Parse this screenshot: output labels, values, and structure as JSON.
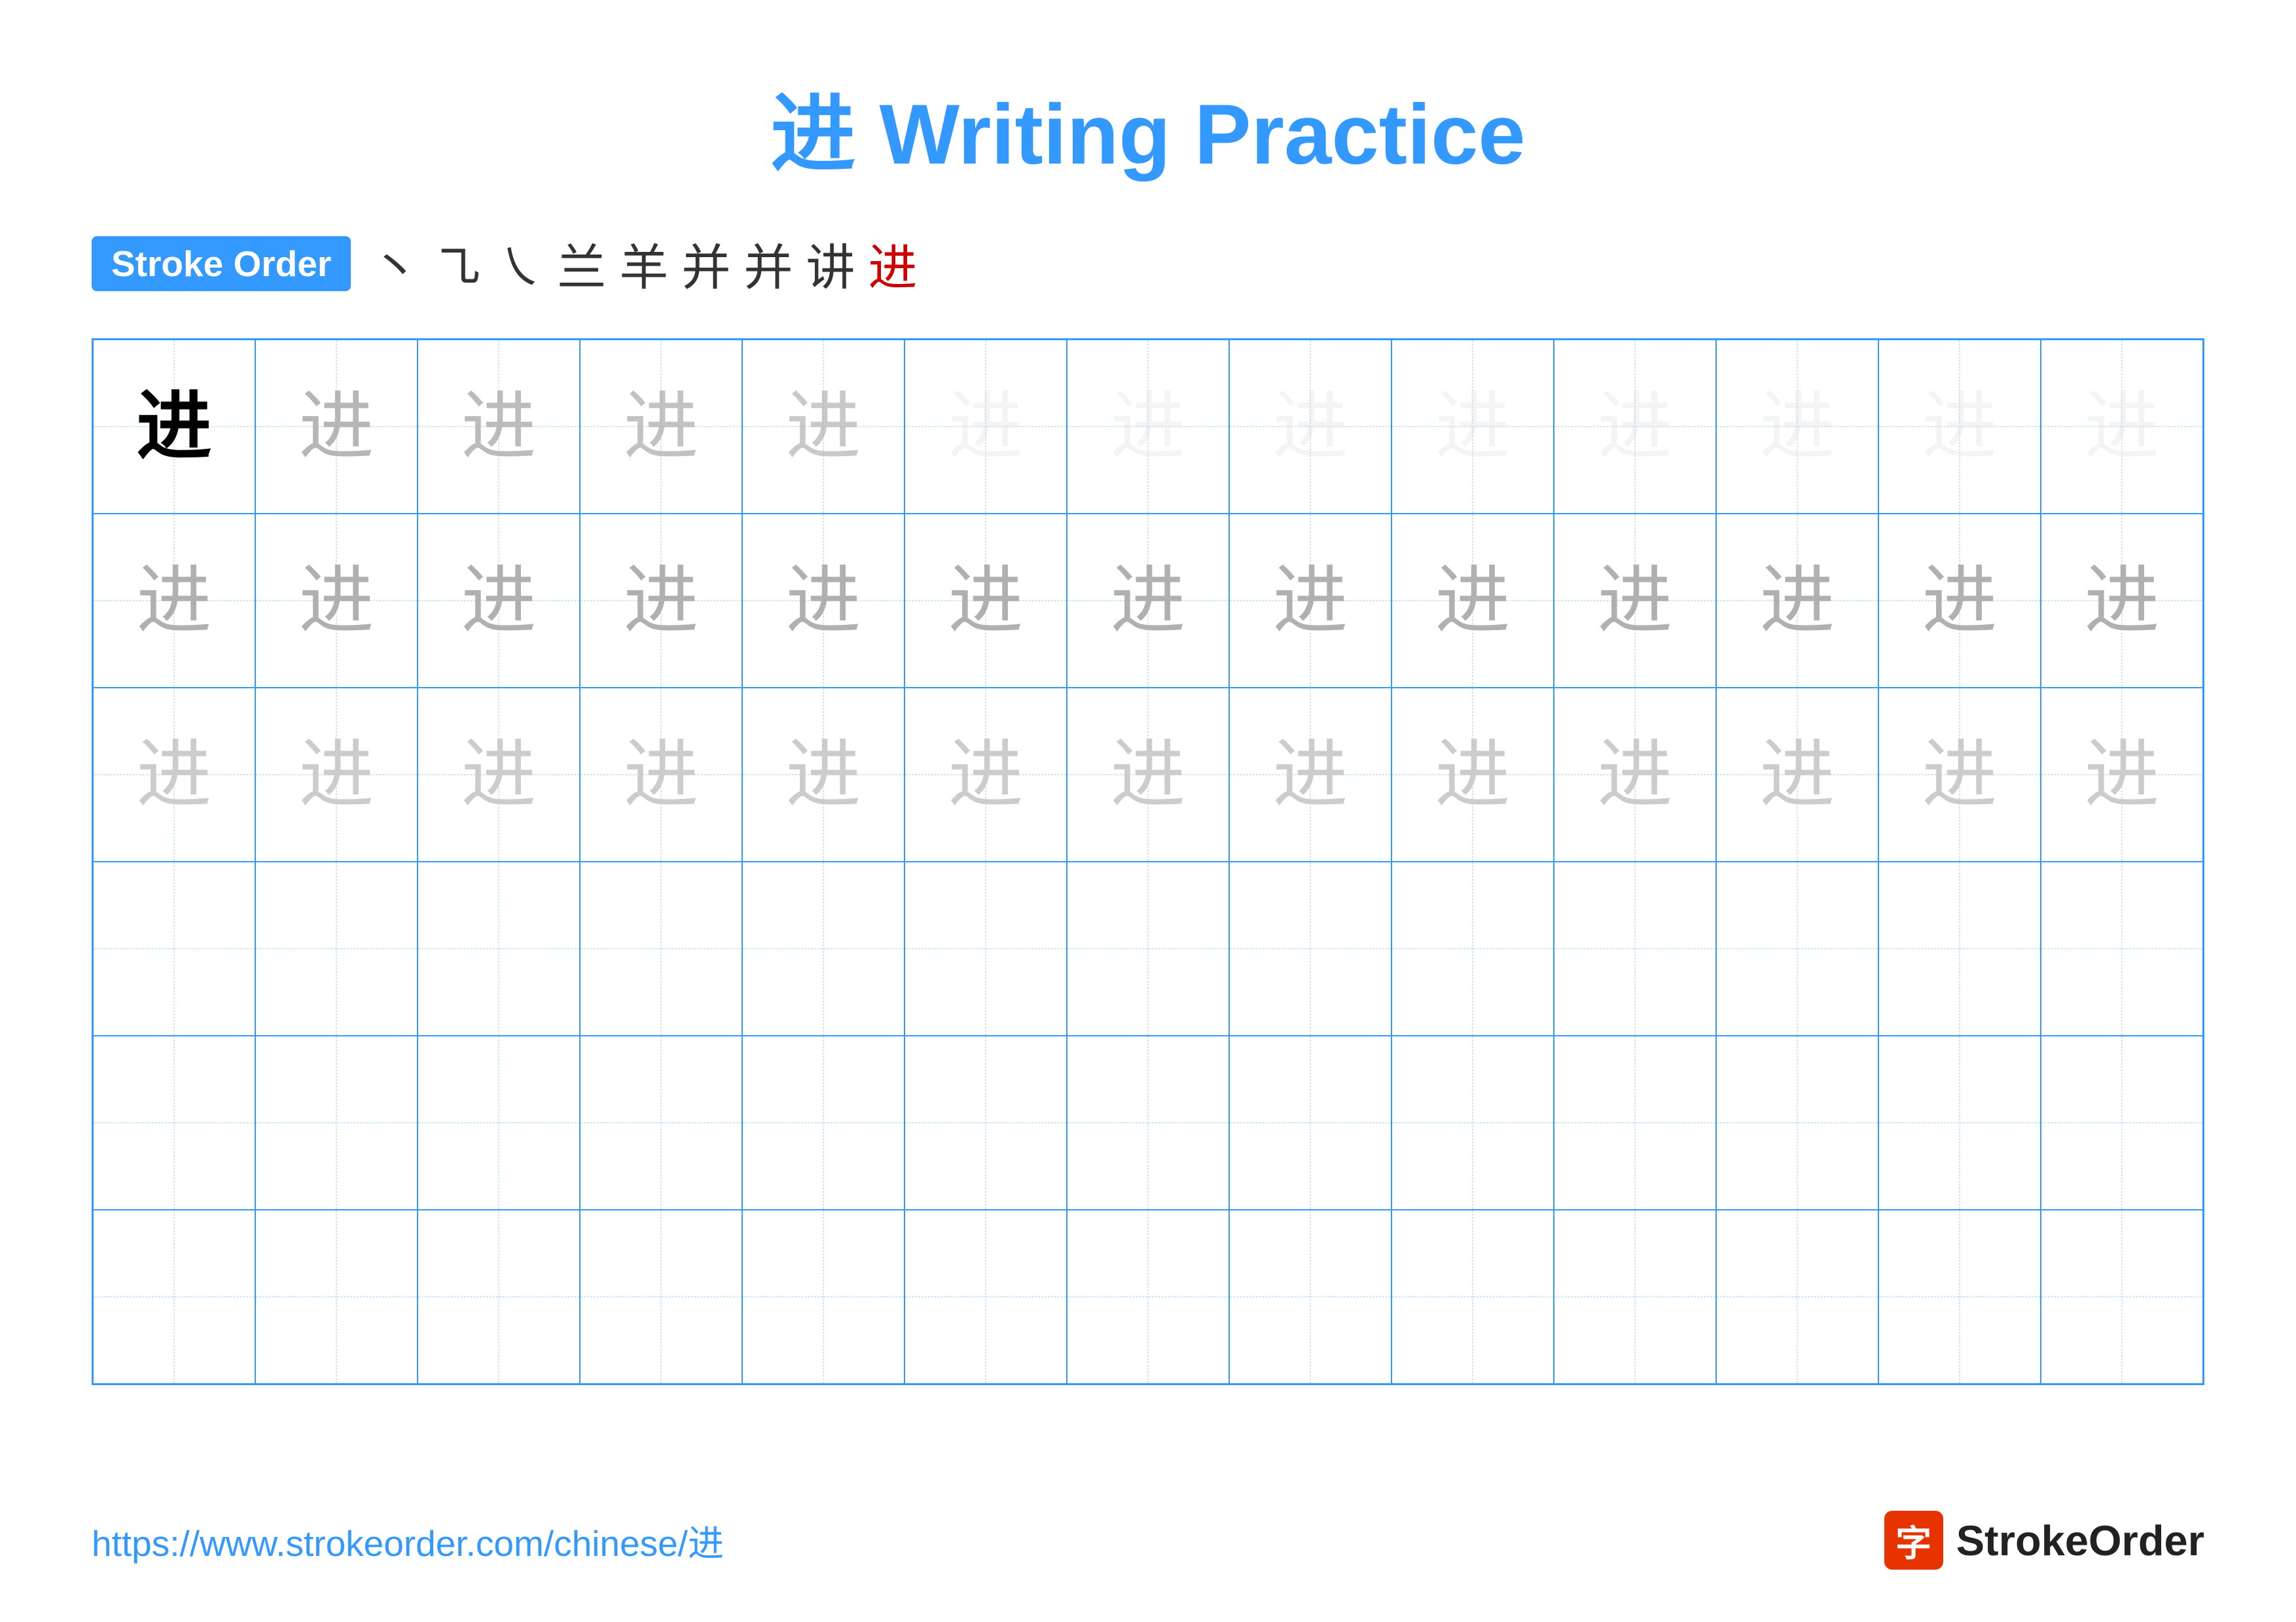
{
  "title": {
    "char": "进",
    "text": "Writing Practice"
  },
  "stroke_order": {
    "badge_label": "Stroke Order",
    "strokes": [
      "丶",
      "㇈",
      "㇏",
      "兰",
      "羊",
      "并",
      "并",
      "讲",
      "进"
    ]
  },
  "grid": {
    "rows": 6,
    "cols": 13,
    "char": "进"
  },
  "footer": {
    "url": "https://www.strokeorder.com/chinese/进",
    "logo_icon": "字",
    "logo_text": "StrokeOrder"
  }
}
